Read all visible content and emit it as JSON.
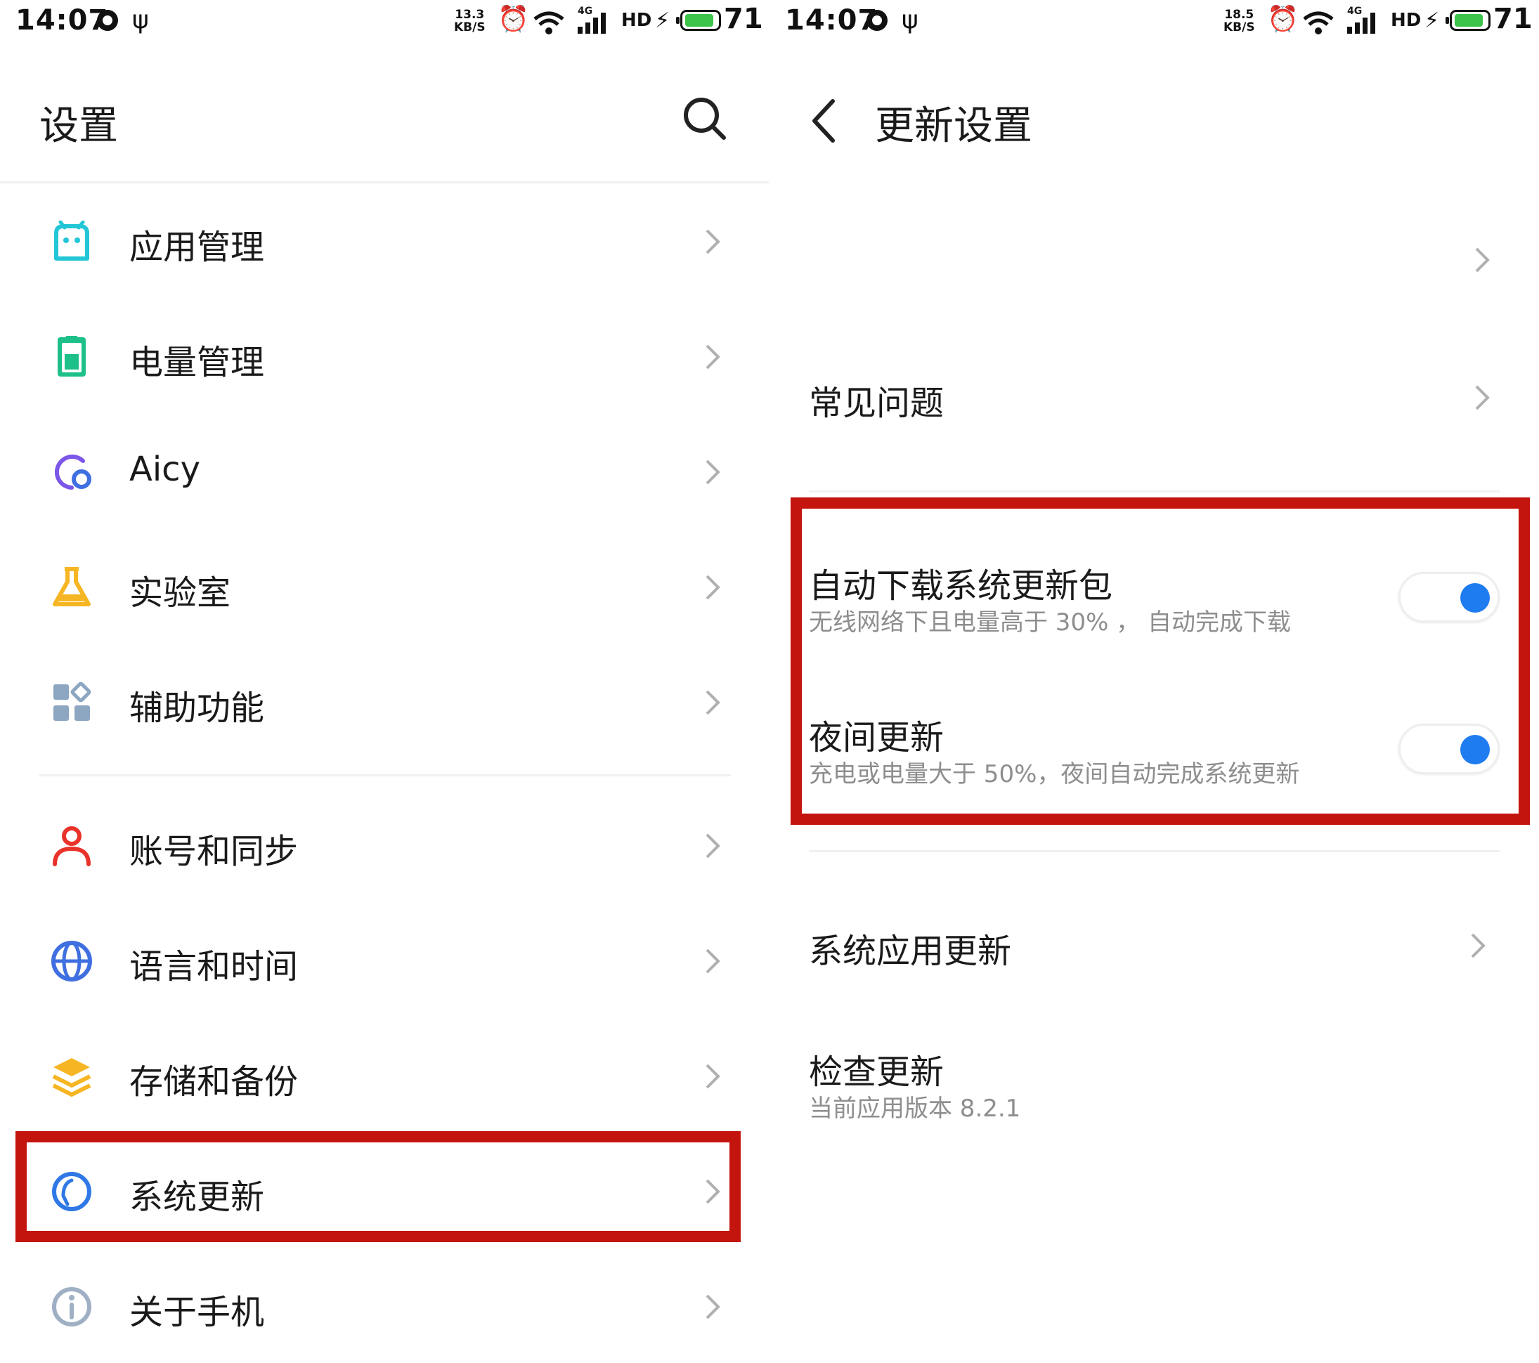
{
  "status_bar_left": {
    "time": "14:07",
    "speed_value": "13.3",
    "speed_unit": "KB/S",
    "network_badge": "4G",
    "hd_label": "HD",
    "battery_level": "71"
  },
  "status_bar_right": {
    "time": "14:07",
    "speed_value": "18.5",
    "speed_unit": "KB/S",
    "network_badge": "4G",
    "hd_label": "HD",
    "battery_level": "71"
  },
  "settings_screen": {
    "title": "设置",
    "items": [
      {
        "label": "应用管理",
        "icon": "app-management-icon",
        "color": "#22c6d6"
      },
      {
        "label": "电量管理",
        "icon": "battery-management-icon",
        "color": "#1cc088"
      },
      {
        "label": "Aicy",
        "icon": "aicy-icon",
        "color": "#7b56e8"
      },
      {
        "label": "实验室",
        "icon": "lab-flask-icon",
        "color": "#f6b623"
      },
      {
        "label": "辅助功能",
        "icon": "accessibility-icon",
        "color": "#8da6c2"
      },
      {
        "label": "账号和同步",
        "icon": "account-icon",
        "color": "#e8322a"
      },
      {
        "label": "语言和时间",
        "icon": "globe-icon",
        "color": "#3f6fe0"
      },
      {
        "label": "存储和备份",
        "icon": "storage-layers-icon",
        "color": "#f6b623"
      },
      {
        "label": "系统更新",
        "icon": "system-update-icon",
        "color": "#2f78e6"
      },
      {
        "label": "关于手机",
        "icon": "info-icon",
        "color": "#9fb0c4"
      }
    ]
  },
  "update_settings_screen": {
    "title": "更新设置",
    "faq_label": "常见问题",
    "auto_download": {
      "label": "自动下载系统更新包",
      "description": "无线网络下且电量高于 30% ， 自动完成下载",
      "enabled": true
    },
    "night_update": {
      "label": "夜间更新",
      "description": "充电或电量大于 50%，夜间自动完成系统更新",
      "enabled": true
    },
    "system_app_update_label": "系统应用更新",
    "check_update": {
      "label": "检查更新",
      "version": "当前应用版本 8.2.1"
    }
  },
  "colors": {
    "highlight": "#c4140e",
    "toggle_on": "#1f7cf0",
    "secondary_text": "#8e8e8e"
  }
}
